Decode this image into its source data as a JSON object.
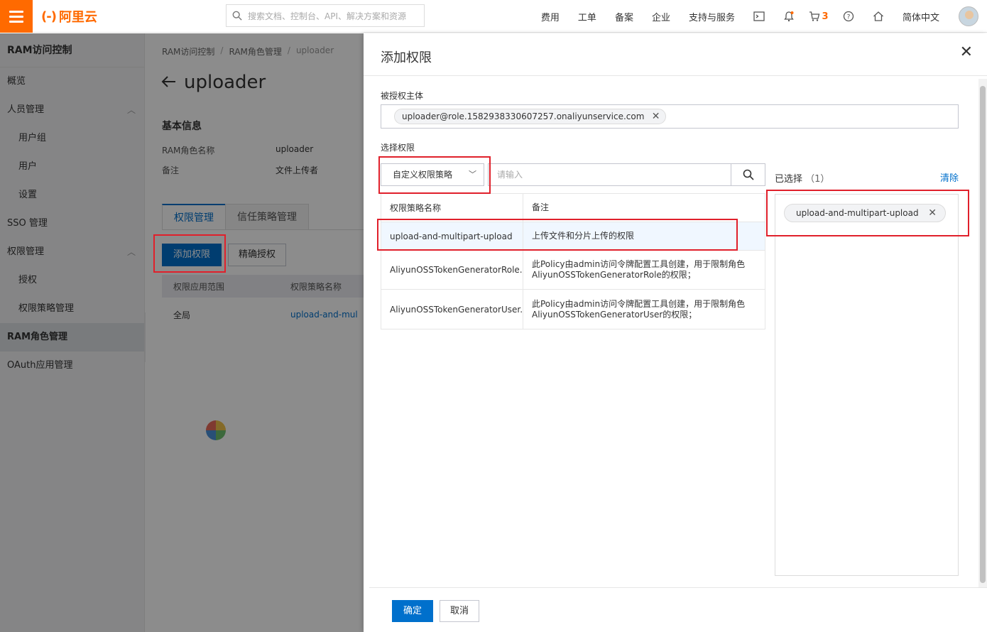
{
  "header": {
    "logo_text": "阿里云",
    "search_placeholder": "搜索文档、控制台、API、解决方案和资源",
    "nav": [
      "费用",
      "工单",
      "备案",
      "企业",
      "支持与服务"
    ],
    "cart_count": "3",
    "language": "简体中文"
  },
  "sidebar": {
    "title": "RAM访问控制",
    "items": [
      {
        "label": "概览"
      },
      {
        "label": "人员管理"
      },
      {
        "label": "用户组"
      },
      {
        "label": "用户"
      },
      {
        "label": "设置"
      },
      {
        "label": "SSO 管理"
      },
      {
        "label": "权限管理"
      },
      {
        "label": "授权"
      },
      {
        "label": "权限策略管理"
      },
      {
        "label": "RAM角色管理"
      },
      {
        "label": "OAuth应用管理"
      }
    ]
  },
  "main": {
    "breadcrumb": [
      "RAM访问控制",
      "RAM角色管理",
      "uploader"
    ],
    "title": "uploader",
    "basic_info_title": "基本信息",
    "role_name_label": "RAM角色名称",
    "role_name_value": "uploader",
    "note_label": "备注",
    "note_value": "文件上传者",
    "tabs": [
      "权限管理",
      "信任策略管理"
    ],
    "add_permission_button": "添加权限",
    "precise_auth_button": "精确授权",
    "table_headers": [
      "权限应用范围",
      "权限策略名称"
    ],
    "table_row": {
      "scope": "全局",
      "policy": "upload-and-mul"
    }
  },
  "drawer": {
    "title": "添加权限",
    "principal_label": "被授权主体",
    "principal_tag": "uploader@role.1582938330607257.onaliyunservice.com",
    "select_label": "选择权限",
    "policy_type": "自定义权限策略",
    "search_placeholder": "请输入",
    "table_headers": {
      "name": "权限策略名称",
      "note": "备注"
    },
    "policies": [
      {
        "name": "upload-and-multipart-upload",
        "note": "上传文件和分片上传的权限"
      },
      {
        "name": "AliyunOSSTokenGeneratorRole...",
        "note": "此Policy由admin访问令牌配置工具创建，用于限制角色AliyunOSSTokenGeneratorRole的权限；"
      },
      {
        "name": "AliyunOSSTokenGeneratorUser...",
        "note": "此Policy由admin访问令牌配置工具创建，用于限制角色AliyunOSSTokenGeneratorUser的权限；"
      }
    ],
    "selected_label": "已选择",
    "selected_count": "（1）",
    "clear_label": "清除",
    "selected_tag": "upload-and-multipart-upload",
    "confirm_button": "确定",
    "cancel_button": "取消"
  },
  "colors": {
    "brand": "#ff6a00",
    "primary": "#0070cc",
    "annotation": "#e0202b"
  }
}
